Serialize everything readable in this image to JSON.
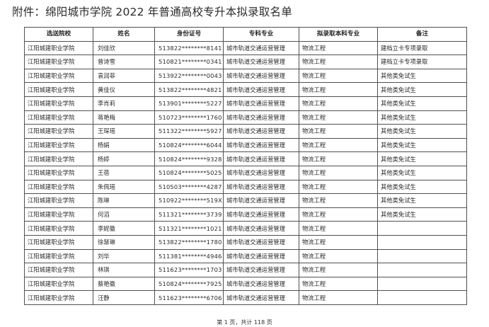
{
  "title": "附件：绵阳城市学院 2022 年普通高校专升本拟录取名单",
  "columns": [
    "选送院校",
    "姓名",
    "身份证号",
    "专科专业",
    "拟录取本科专业",
    "备注"
  ],
  "rows": [
    [
      "江阳城建职业学院",
      "刘佳欣",
      "513822********8141",
      "城市轨道交通运营管理",
      "物流工程",
      "建档立卡专项录取"
    ],
    [
      "江阳城建职业学院",
      "曾诗雪",
      "510821********0341",
      "城市轨道交通运营管理",
      "物流工程",
      "建档立卡专项录取"
    ],
    [
      "江阳城建职业学院",
      "袁润菲",
      "513922********0043",
      "城市轨道交通运营管理",
      "物流工程",
      "其他类免试生"
    ],
    [
      "江阳城建职业学院",
      "黄佳仪",
      "513822********4821",
      "城市轨道交通运营管理",
      "物流工程",
      "其他类免试生"
    ],
    [
      "江阳城建职业学院",
      "李肖莉",
      "513901********5227",
      "城市轨道交通运营管理",
      "物流工程",
      "其他类免试生"
    ],
    [
      "江阳城建职业学院",
      "蒋艳梅",
      "510723********1760",
      "城市轨道交通运营管理",
      "物流工程",
      "其他类免试生"
    ],
    [
      "江阳城建职业学院",
      "王琛瑶",
      "511322********5927",
      "城市轨道交通运营管理",
      "物流工程",
      "其他类免试生"
    ],
    [
      "江阳城建职业学院",
      "杨娟",
      "510824********6044",
      "城市轨道交通运营管理",
      "物流工程",
      "其他类免试生"
    ],
    [
      "江阳城建职业学院",
      "杨婷",
      "510824********9328",
      "城市轨道交通运营管理",
      "物流工程",
      "其他类免试生"
    ],
    [
      "江阳城建职业学院",
      "王蓓",
      "510824********5025",
      "城市轨道交通运营管理",
      "物流工程",
      "其他类免试生"
    ],
    [
      "江阳城建职业学院",
      "朱佩瑶",
      "510503********4287",
      "城市轨道交通运营管理",
      "物流工程",
      "其他类免试生"
    ],
    [
      "江阳城建职业学院",
      "陈琳",
      "510922********519X",
      "城市轨道交通运营管理",
      "物流工程",
      "其他类免试生"
    ],
    [
      "江阳城建职业学院",
      "何滔",
      "511321********3739",
      "城市轨道交通运营管理",
      "物流工程",
      "其他类免试生"
    ],
    [
      "江阳城建职业学院",
      "李妮徽",
      "511321********1021",
      "城市轨道交通运营管理",
      "物流工程",
      ""
    ],
    [
      "江阳城建职业学院",
      "徐慧琳",
      "513822********1780",
      "城市轨道交通运营管理",
      "物流工程",
      ""
    ],
    [
      "江阳城建职业学院",
      "刘华",
      "511381********4946",
      "城市轨道交通运营管理",
      "物流工程",
      ""
    ],
    [
      "江阳城建职业学院",
      "林琪",
      "511623********1703",
      "城市轨道交通运营管理",
      "物流工程",
      ""
    ],
    [
      "江阳城建职业学院",
      "蔡艳徽",
      "510824********7925",
      "城市轨道交通运营管理",
      "物流工程",
      ""
    ],
    [
      "江阳城建职业学院",
      "汪静",
      "511623********6706",
      "城市轨道交通运营管理",
      "物流工程",
      ""
    ]
  ],
  "footer": "第 1 页，共计 118 页"
}
